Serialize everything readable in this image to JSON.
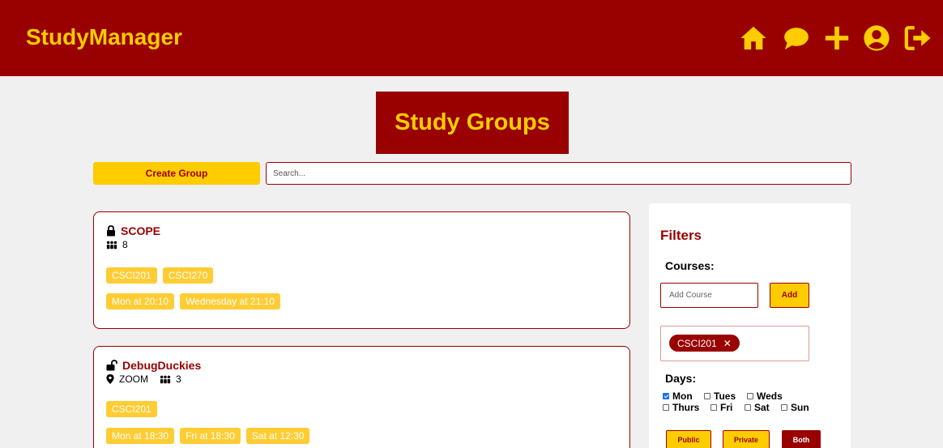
{
  "header": {
    "brand": "StudyManager",
    "icons": [
      "home-icon",
      "chat-icon",
      "plus-icon",
      "user-icon",
      "logout-icon"
    ],
    "accent": "#ffcc00",
    "background": "#990000"
  },
  "page_title": "Study Groups",
  "toolbar": {
    "create_label": "Create Group",
    "search_placeholder": "Search..."
  },
  "groups": [
    {
      "name": "SCOPE",
      "lock": "locked",
      "location": "",
      "members": "8",
      "courses": [
        "CSCI201",
        "CSCI270"
      ],
      "times": [
        "Mon at 20:10",
        "Wednesday at 21:10"
      ]
    },
    {
      "name": "DebugDuckies",
      "lock": "unlocked",
      "location": "ZOOM",
      "members": "3",
      "courses": [
        "CSCI201"
      ],
      "times": [
        "Mon at 18:30",
        "Fri at 18:30",
        "Sat at 12:30"
      ]
    }
  ],
  "filters": {
    "title": "Filters",
    "courses_label": "Courses:",
    "add_course_placeholder": "Add Course",
    "add_label": "Add",
    "selected_courses": [
      "CSCI201"
    ],
    "days_label": "Days:",
    "days": [
      {
        "label": "Mon",
        "checked": true
      },
      {
        "label": "Tues",
        "checked": false
      },
      {
        "label": "Weds",
        "checked": false
      },
      {
        "label": "Thurs",
        "checked": false
      },
      {
        "label": "Fri",
        "checked": false
      },
      {
        "label": "Sat",
        "checked": false
      },
      {
        "label": "Sun",
        "checked": false
      }
    ],
    "visibility": [
      "Public",
      "Private",
      "Both"
    ],
    "visibility_selected": "Both"
  }
}
